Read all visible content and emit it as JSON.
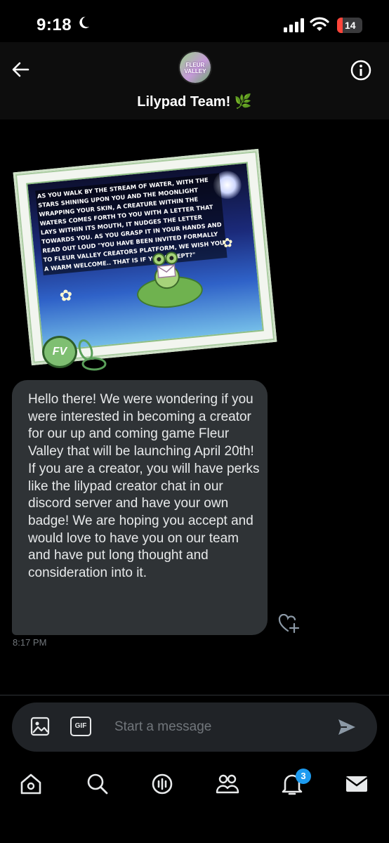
{
  "status_bar": {
    "time": "9:18",
    "battery": "14"
  },
  "header": {
    "title": "Lilypad Team! 🌿",
    "avatar_text": "FLEUR VALLEY"
  },
  "card": {
    "text": "As you walk by the stream of water, with the stars shining upon you and the moonlight wrapping your skin, a creature within the waters comes forth to you with a letter that lays within its mouth, it nudges the letter towards you. As you grasp it in your hands and read out loud \"You have been invited formally to Fleur Valley creators platform, we wish you a warm welcome.. that is if you accept?\"",
    "seal_text": "FV"
  },
  "message": {
    "text": "Hello there! We were wondering if you were interested in becoming a creator for our up and coming game Fleur Valley that will be launching April 20th! If you are a creator, you will have perks like the lilypad creator chat in our discord server and have your own badge! We are hoping you accept and would love to have you on our team and have put long thought and consideration into it.",
    "time": "8:17 PM"
  },
  "composer": {
    "gif_label": "GIF",
    "placeholder": "Start a message"
  },
  "tabbar": {
    "notifications_count": "3"
  },
  "colors": {
    "accent": "#1d9bf0",
    "bubble": "#2f3336",
    "battery_low": "#ff453a"
  }
}
